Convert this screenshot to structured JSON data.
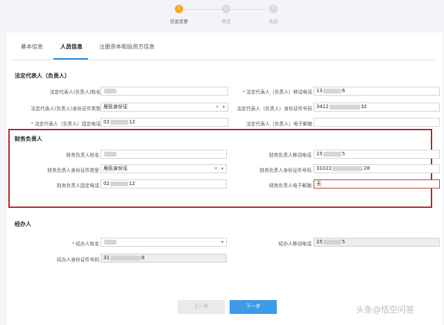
{
  "stepper": {
    "steps": [
      {
        "num": "1",
        "label": "信息变更"
      },
      {
        "num": "2",
        "label": "预览"
      },
      {
        "num": "3",
        "label": "完成"
      }
    ]
  },
  "tabs": [
    "基本信息",
    "人员信息",
    "注册资本和投资方信息"
  ],
  "legal": {
    "title": "法定代表人（负责人）",
    "name_label": "法定代表人(负责人)姓名",
    "mobile_label": "法定代表人（负责人）移动电话",
    "mobile_prefix": "13",
    "mobile_suffix": "6",
    "idtype_label": "法定代表人(负责人)身份证件类型",
    "idtype_value": "居民身份证",
    "idno_label": "法定代表人（负责人）身份证件号码",
    "idno_prefix": "3412",
    "idno_suffix": "32",
    "phone_label": "法定代表人（负责人）固定电话",
    "phone_prefix": "02",
    "phone_suffix": "12",
    "email_label": "法定代表人（负责人）电子邮箱"
  },
  "finance": {
    "title": "财务负责人",
    "name_label": "财务负责人姓名",
    "mobile_label": "财务负责人移动电话",
    "mobile_prefix": "15",
    "mobile_suffix": "5",
    "idtype_label": "财务负责人身份证件类型",
    "idtype_value": "居民身份证",
    "idno_label": "财务负责人身份证件号码",
    "idno_prefix": "31022",
    "idno_suffix": "28",
    "phone_label": "财务负责人固定电话",
    "phone_prefix": "02",
    "phone_suffix": "12",
    "email_label": "财务负责人电子邮箱",
    "email_value": "无"
  },
  "agent": {
    "title": "经办人",
    "name_label": "经办人姓名",
    "mobile_label": "经办人移动电话",
    "mobile_prefix": "15",
    "mobile_suffix": "5",
    "idno_label": "经办人身份证件号码",
    "idno_prefix": "31",
    "idno_suffix": "8"
  },
  "buttons": {
    "prev": "上一步",
    "next": "下一步"
  },
  "watermark": "头条@悟空问答",
  "icons": {
    "clear": "×",
    "caret": "▾",
    "required": "*"
  }
}
